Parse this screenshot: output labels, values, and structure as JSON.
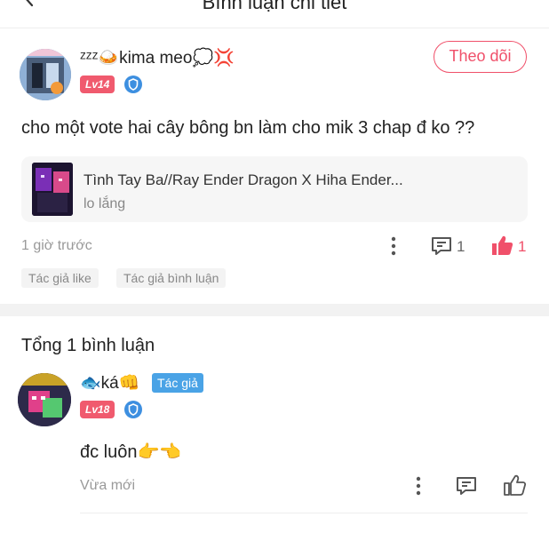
{
  "header": {
    "title": "Bình luận chi tiết"
  },
  "comment": {
    "username": "ᶻᶻᶻ🍛kima meo💭💢",
    "level": "Lv14",
    "follow_label": "Theo dõi",
    "text": "cho một vote hai cây bông bn làm cho mik 3 chap đ ko ??",
    "linked": {
      "title": "Tình Tay Ba//Ray Ender Dragon X Hiha Ender...",
      "subtitle": "lo lắng"
    },
    "time": "1 giờ trước",
    "reply_count": "1",
    "like_count": "1",
    "tags": [
      "Tác giả like",
      "Tác giả bình luận"
    ]
  },
  "replies_header": "Tổng 1 bình luận",
  "reply": {
    "username": "🐟ká👊",
    "author_tag": "Tác giả",
    "level": "Lv18",
    "text": "đc luôn👉👈",
    "time": "Vừa mới"
  },
  "colors": {
    "accent": "#f0506a",
    "level": "#f05a6e",
    "author_tag": "#4aa3e6",
    "shield": "#3d8fe0"
  },
  "icons": [
    "back-icon",
    "shield-icon",
    "more-icon",
    "comment-icon",
    "thumbs-up-icon"
  ]
}
